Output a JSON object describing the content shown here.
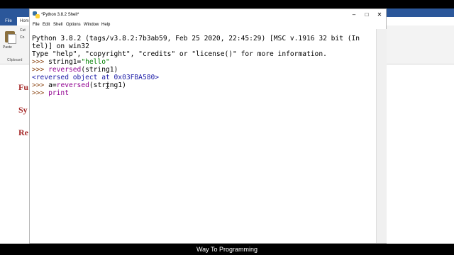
{
  "word": {
    "file_tab": "File",
    "home_tab": "Hom",
    "paste_label": "Paste",
    "cut_label": "Cut",
    "copy_label": "Co",
    "clipboard_label": "Clipboard",
    "headings": [
      "Fu",
      "Sy",
      "Re"
    ]
  },
  "idle": {
    "title": "*Python 3.8.2 Shell*",
    "menu": [
      "File",
      "Edit",
      "Shell",
      "Options",
      "Window",
      "Help"
    ],
    "window_buttons": {
      "minimize": "–",
      "maximize": "□",
      "close": "✕"
    },
    "shell_lines": [
      {
        "parts": [
          {
            "t": "Python 3.8.2 (tags/v3.8.2:7b3ab59, Feb 25 2020, 22:45:29) [MSC v.1916 32 bit (In",
            "c": ""
          }
        ]
      },
      {
        "parts": [
          {
            "t": "tel)] on win32",
            "c": ""
          }
        ]
      },
      {
        "parts": [
          {
            "t": "Type \"help\", \"copyright\", \"credits\" or \"license()\" for more information.",
            "c": ""
          }
        ]
      },
      {
        "parts": [
          {
            "t": ">>> ",
            "c": "prompt"
          },
          {
            "t": "string1=",
            "c": ""
          },
          {
            "t": "\"hello\"",
            "c": "str"
          }
        ]
      },
      {
        "parts": [
          {
            "t": ">>> ",
            "c": "prompt"
          },
          {
            "t": "reversed",
            "c": "builtin"
          },
          {
            "t": "(string1)",
            "c": ""
          }
        ]
      },
      {
        "parts": [
          {
            "t": "<reversed object at 0x03FBA580>",
            "c": "out"
          }
        ]
      },
      {
        "parts": [
          {
            "t": ">>> ",
            "c": "prompt"
          },
          {
            "t": "a=",
            "c": ""
          },
          {
            "t": "reversed",
            "c": "builtin"
          },
          {
            "t": "(string1)",
            "c": ""
          }
        ]
      },
      {
        "parts": [
          {
            "t": ">>> ",
            "c": "prompt"
          },
          {
            "t": "print",
            "c": "builtin"
          }
        ]
      }
    ]
  },
  "caption": "Way To Programming"
}
